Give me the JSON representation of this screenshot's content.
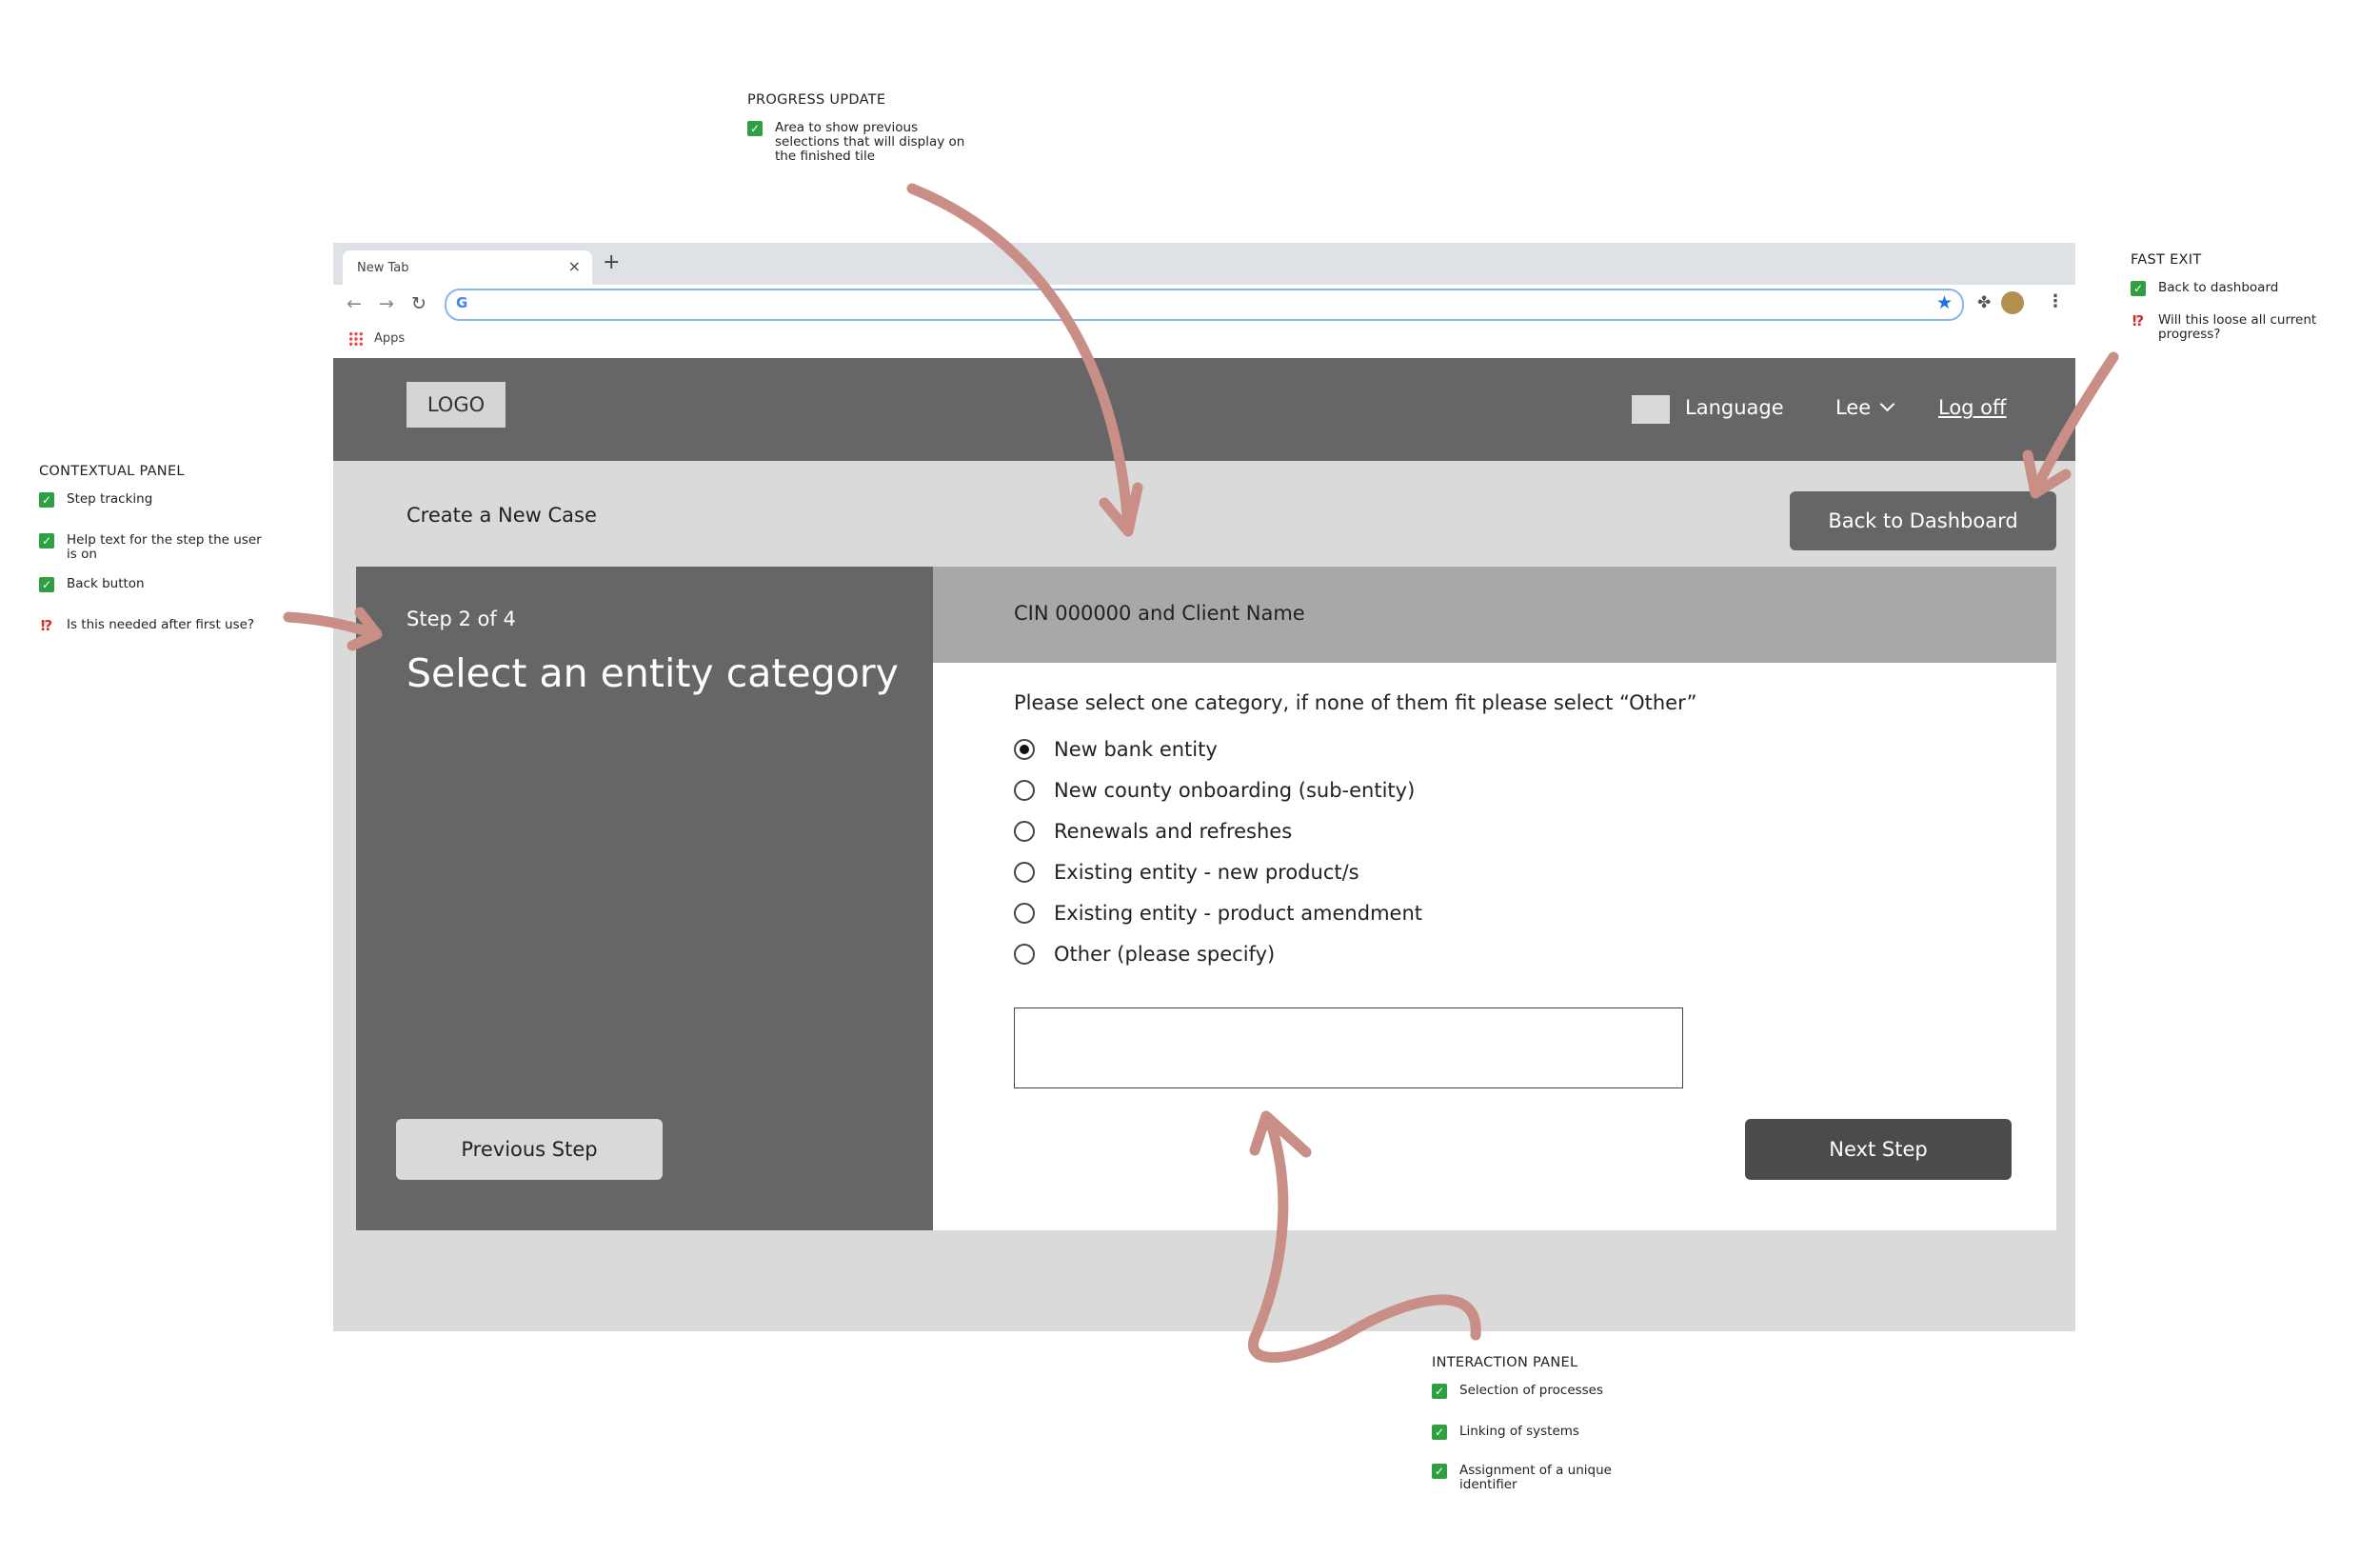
{
  "annotations": {
    "progress": {
      "title": "PROGRESS UPDATE",
      "items": [
        {
          "mark": "check",
          "text": "Area to show previous\nselections that will display on\nthe finished tile"
        }
      ]
    },
    "fast_exit": {
      "title": "FAST EXIT",
      "items": [
        {
          "mark": "check",
          "text": "Back to dashboard"
        },
        {
          "mark": "warn",
          "text": "Will this loose all current\nprogress?"
        }
      ]
    },
    "contextual": {
      "title": "CONTEXTUAL PANEL",
      "items": [
        {
          "mark": "check",
          "text": "Step tracking"
        },
        {
          "mark": "check",
          "text": "Help text for the step the user\nis on"
        },
        {
          "mark": "check",
          "text": "Back button"
        },
        {
          "mark": "warn",
          "text": "Is this needed after first use?"
        }
      ]
    },
    "interaction": {
      "title": "INTERACTION PANEL",
      "items": [
        {
          "mark": "check",
          "text": "Selection of processes"
        },
        {
          "mark": "check",
          "text": "Linking of systems"
        },
        {
          "mark": "check",
          "text": "Assignment of a unique\nidentifier"
        }
      ]
    }
  },
  "browser": {
    "tab_title": "New Tab",
    "close_glyph": "×",
    "new_tab_glyph": "+",
    "apps_label": "Apps"
  },
  "header": {
    "logo": "LOGO",
    "language": "Language",
    "user": "Lee",
    "logoff": "Log off"
  },
  "page": {
    "title": "Create a New Case",
    "back_button": "Back to Dashboard"
  },
  "context_panel": {
    "step_label": "Step 2 of 4",
    "step_title": "Select an entity category",
    "prev_button": "Previous Step"
  },
  "interaction_panel": {
    "client": "CIN 000000 and Client Name",
    "instruction": "Please select one category, if none of them fit please select “Other”",
    "options": [
      {
        "label": "New bank entity",
        "selected": true
      },
      {
        "label": "New county onboarding (sub-entity)",
        "selected": false
      },
      {
        "label": "Renewals and refreshes",
        "selected": false
      },
      {
        "label": "Existing entity - new product/s",
        "selected": false
      },
      {
        "label": "Existing entity - product amendment",
        "selected": false
      },
      {
        "label": "Other (please specify)",
        "selected": false
      }
    ],
    "other_input_value": "",
    "next_button": "Next Step"
  },
  "colors": {
    "header_bg": "#666666",
    "panel_dark": "#666666",
    "client_bar": "#a8a8a6",
    "next_button": "#4b4b4b",
    "arrow": "#c98f86",
    "check": "#2ea043",
    "warn": "#d12f2f"
  }
}
